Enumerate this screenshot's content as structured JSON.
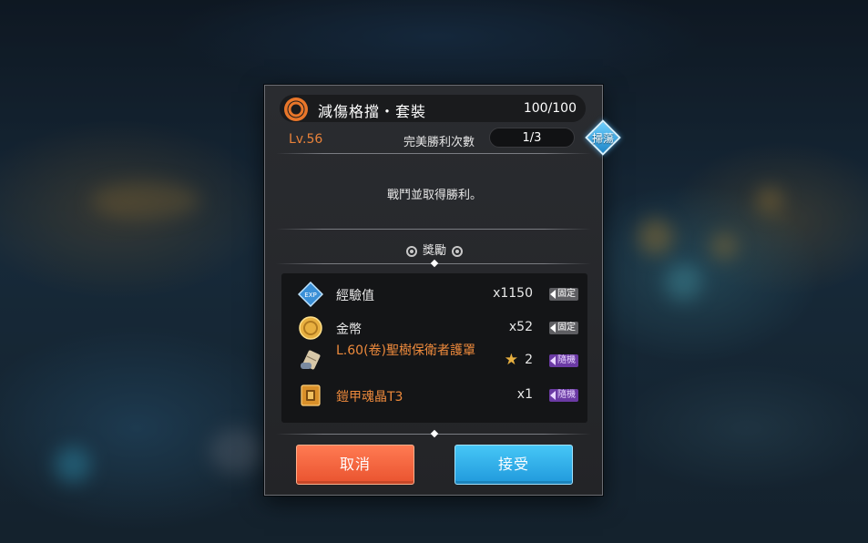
{
  "header": {
    "title": "減傷格擋・套裝",
    "count": "100/100",
    "level": "Lv.56",
    "perfect_label": "完美勝利次數",
    "perfect_value": "1/3",
    "sweep_label": "掃蕩"
  },
  "description": "戰鬥並取得勝利。",
  "rewards": {
    "title": "獎勵",
    "items": [
      {
        "icon": "exp-icon",
        "name": "經驗值",
        "quantity": "x1150",
        "tag": "固定",
        "tag_type": "fixed"
      },
      {
        "icon": "gold-coin-icon",
        "name": "金幣",
        "quantity": "x52",
        "tag": "固定",
        "tag_type": "fixed"
      },
      {
        "icon": "scroll-icon",
        "name": "L.60(卷)聖樹保衛者護罩",
        "quantity": "2",
        "star_icon": "star-icon",
        "tag": "隨機",
        "tag_type": "random"
      },
      {
        "icon": "soul-crystal-icon",
        "name": "鎧甲魂晶T3",
        "quantity": "x1",
        "tag": "隨機",
        "tag_type": "random"
      }
    ]
  },
  "buttons": {
    "cancel": "取消",
    "accept": "接受"
  },
  "colors": {
    "level": "#e8823a",
    "item_name_highlight": "#ee8a3c",
    "cancel_button": "#f0643a",
    "accept_button": "#2ea8e8",
    "sweep_badge": "#3aa6e6",
    "random_tag": "#6b3aa4",
    "fixed_tag": "#5e5e62"
  }
}
